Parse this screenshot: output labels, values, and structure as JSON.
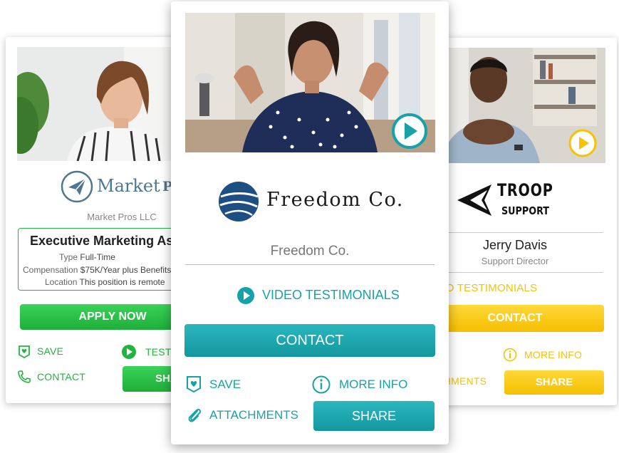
{
  "left_card": {
    "logo_text_a": "Market",
    "logo_text_b": "Pros",
    "company": "Market Pros LLC",
    "job_title": "Executive Marketing Assistant",
    "type_label": "Type",
    "type_value": "Full-Time",
    "comp_label": "Compensation",
    "comp_value": "$75K/Year plus Benefits",
    "loc_label": "Location",
    "loc_value": "This position is remote",
    "apply": "APPLY NOW",
    "save": "SAVE",
    "testimonials": "TESTIMONIALS",
    "contact": "CONTACT",
    "share": "SHARE"
  },
  "center_card": {
    "logo_text": "Freedom Co.",
    "company": "Freedom Co.",
    "video_testimonials": "VIDEO TESTIMONIALS",
    "contact": "CONTACT",
    "save": "SAVE",
    "more_info": "MORE INFO",
    "attachments": "ATTACHMENTS",
    "share": "SHARE"
  },
  "right_card": {
    "logo_line1": "TROOP",
    "logo_line2": "SUPPORT",
    "name": "Jerry Davis",
    "role": "Support Director",
    "video_testimonials": "VIDEO TESTIMONIALS",
    "contact": "CONTACT",
    "more_info": "MORE INFO",
    "attachments": "ATTACHMENTS",
    "share": "SHARE"
  },
  "colors": {
    "green": "#22b43e",
    "teal": "#17a2a9",
    "yellow": "#f7c200",
    "navy": "#1d4f83",
    "slate": "#4d7790"
  },
  "icons": [
    "play-icon",
    "save-heart-icon",
    "phone-icon",
    "info-icon",
    "paperclip-icon",
    "paper-plane-icon",
    "globe-logo-icon",
    "troop-logo-icon"
  ]
}
